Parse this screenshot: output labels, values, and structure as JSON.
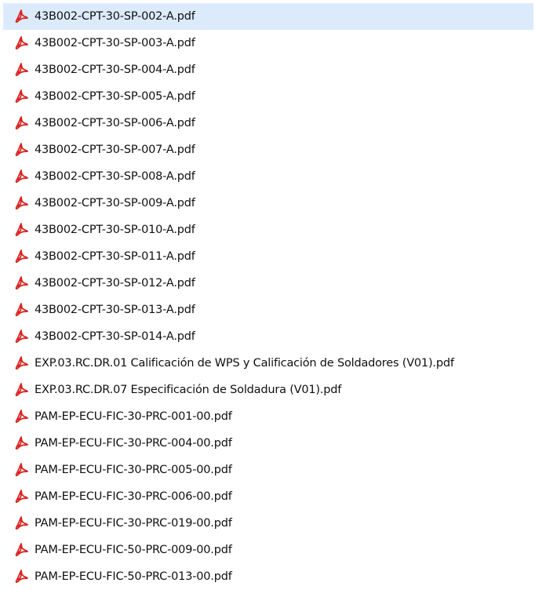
{
  "files": [
    {
      "name": "43B002-CPT-30-SP-002-A.pdf",
      "icon": "pdf-file-icon",
      "selected": true
    },
    {
      "name": "43B002-CPT-30-SP-003-A.pdf",
      "icon": "pdf-file-icon",
      "selected": false
    },
    {
      "name": "43B002-CPT-30-SP-004-A.pdf",
      "icon": "pdf-file-icon",
      "selected": false
    },
    {
      "name": "43B002-CPT-30-SP-005-A.pdf",
      "icon": "pdf-file-icon",
      "selected": false
    },
    {
      "name": "43B002-CPT-30-SP-006-A.pdf",
      "icon": "pdf-file-icon",
      "selected": false
    },
    {
      "name": "43B002-CPT-30-SP-007-A.pdf",
      "icon": "pdf-file-icon",
      "selected": false
    },
    {
      "name": "43B002-CPT-30-SP-008-A.pdf",
      "icon": "pdf-file-icon",
      "selected": false
    },
    {
      "name": "43B002-CPT-30-SP-009-A.pdf",
      "icon": "pdf-file-icon",
      "selected": false
    },
    {
      "name": "43B002-CPT-30-SP-010-A.pdf",
      "icon": "pdf-file-icon",
      "selected": false
    },
    {
      "name": "43B002-CPT-30-SP-011-A.pdf",
      "icon": "pdf-file-icon",
      "selected": false
    },
    {
      "name": "43B002-CPT-30-SP-012-A.pdf",
      "icon": "pdf-file-icon",
      "selected": false
    },
    {
      "name": "43B002-CPT-30-SP-013-A.pdf",
      "icon": "pdf-file-icon",
      "selected": false
    },
    {
      "name": "43B002-CPT-30-SP-014-A.pdf",
      "icon": "pdf-file-icon",
      "selected": false
    },
    {
      "name": "EXP.03.RC.DR.01 Calificación de WPS y Calificación de Soldadores (V01).pdf",
      "icon": "pdf-file-icon",
      "selected": false
    },
    {
      "name": "EXP.03.RC.DR.07 Especificación de Soldadura (V01).pdf",
      "icon": "pdf-file-icon",
      "selected": false
    },
    {
      "name": "PAM-EP-ECU-FIC-30-PRC-001-00.pdf",
      "icon": "pdf-file-icon",
      "selected": false
    },
    {
      "name": "PAM-EP-ECU-FIC-30-PRC-004-00.pdf",
      "icon": "pdf-file-icon",
      "selected": false
    },
    {
      "name": "PAM-EP-ECU-FIC-30-PRC-005-00.pdf",
      "icon": "pdf-file-icon",
      "selected": false
    },
    {
      "name": "PAM-EP-ECU-FIC-30-PRC-006-00.pdf",
      "icon": "pdf-file-icon",
      "selected": false
    },
    {
      "name": "PAM-EP-ECU-FIC-30-PRC-019-00.pdf",
      "icon": "pdf-file-icon",
      "selected": false
    },
    {
      "name": "PAM-EP-ECU-FIC-50-PRC-009-00.pdf",
      "icon": "pdf-file-icon",
      "selected": false
    },
    {
      "name": "PAM-EP-ECU-FIC-50-PRC-013-00.pdf",
      "icon": "pdf-file-icon",
      "selected": false
    }
  ],
  "colors": {
    "selection": "#dcebfc",
    "pdf_icon": "#d9231f",
    "text": "#101010"
  }
}
